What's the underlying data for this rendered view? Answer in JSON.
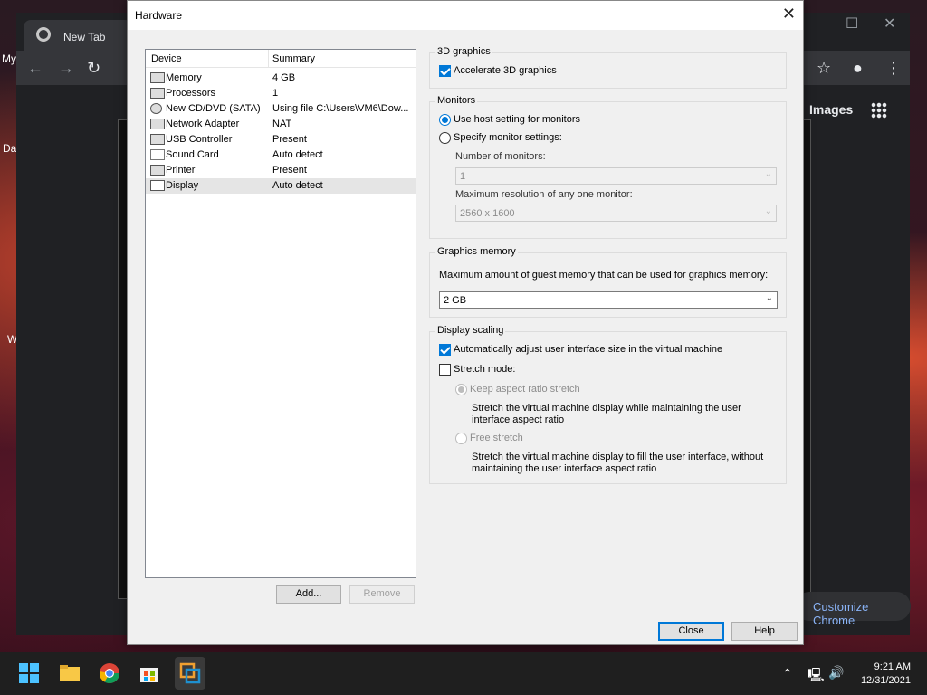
{
  "desktop": {
    "icon_labels": [
      "My",
      "Da",
      "W"
    ]
  },
  "chrome": {
    "tab_title": "New Tab",
    "images_link": "Images",
    "customize_button": "Customize Chrome"
  },
  "dialog": {
    "title": "Hardware",
    "device_list": {
      "header_device": "Device",
      "header_summary": "Summary",
      "rows": [
        {
          "name": "Memory",
          "summary": "4 GB",
          "icon": "memory-icon"
        },
        {
          "name": "Processors",
          "summary": "1",
          "icon": "processor-icon"
        },
        {
          "name": "New CD/DVD (SATA)",
          "summary": "Using file C:\\Users\\VM6\\Dow...",
          "icon": "cd-dvd-icon"
        },
        {
          "name": "Network Adapter",
          "summary": "NAT",
          "icon": "network-adapter-icon"
        },
        {
          "name": "USB Controller",
          "summary": "Present",
          "icon": "usb-icon"
        },
        {
          "name": "Sound Card",
          "summary": "Auto detect",
          "icon": "sound-card-icon"
        },
        {
          "name": "Printer",
          "summary": "Present",
          "icon": "printer-icon"
        },
        {
          "name": "Display",
          "summary": "Auto detect",
          "icon": "display-icon",
          "selected": true
        }
      ]
    },
    "add_button": "Add...",
    "remove_button": "Remove",
    "close_button": "Close",
    "help_button": "Help",
    "graphics_3d": {
      "title": "3D graphics",
      "accelerate_label": "Accelerate 3D graphics",
      "accelerate_checked": true
    },
    "monitors": {
      "title": "Monitors",
      "use_host_label": "Use host setting for monitors",
      "specify_label": "Specify monitor settings:",
      "number_label": "Number of monitors:",
      "number_value": "1",
      "max_res_label": "Maximum resolution of any one monitor:",
      "max_res_value": "2560 x 1600"
    },
    "graphics_memory": {
      "title": "Graphics memory",
      "description": "Maximum amount of guest memory that can be used for graphics memory:",
      "value": "2 GB"
    },
    "display_scaling": {
      "title": "Display scaling",
      "auto_adjust_label": "Automatically adjust user interface size in the virtual machine",
      "auto_adjust_checked": true,
      "stretch_label": "Stretch mode:",
      "stretch_checked": false,
      "keep_aspect_label": "Keep aspect ratio stretch",
      "keep_aspect_desc_1": "Stretch the virtual machine display while maintaining the user",
      "keep_aspect_desc_2": "interface aspect ratio",
      "free_stretch_label": "Free stretch",
      "free_stretch_desc_1": "Stretch the virtual machine display to fill the user interface, without",
      "free_stretch_desc_2": "maintaining the user interface aspect ratio"
    }
  },
  "taskbar": {
    "time": "9:21 AM",
    "date": "12/31/2021"
  }
}
